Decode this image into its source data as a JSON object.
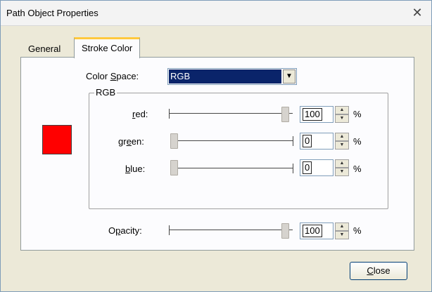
{
  "window": {
    "title": "Path Object Properties",
    "close_glyph": "✕"
  },
  "tabs": [
    {
      "label": "General",
      "active": false
    },
    {
      "label": "Stroke Color",
      "active": true
    }
  ],
  "color_space": {
    "label_pre": "Color ",
    "label_u": "S",
    "label_post": "pace:",
    "value": "RGB",
    "arrow": "▼"
  },
  "rgb_group": {
    "legend": "RGB"
  },
  "swatch": {
    "color": "#ff0000"
  },
  "channels": {
    "red": {
      "label_u": "r",
      "label_post": "ed:",
      "value": "100",
      "level": 1.0
    },
    "green": {
      "label_pre": "gr",
      "label_u": "e",
      "label_post": "en:",
      "value": "0",
      "level": 0.0
    },
    "blue": {
      "label_u": "b",
      "label_post": "lue:",
      "value": "0",
      "level": 0.0
    }
  },
  "opacity": {
    "label_pre": "O",
    "label_u": "p",
    "label_post": "acity:",
    "value": "100",
    "level": 1.0
  },
  "units": {
    "percent": "%"
  },
  "spin_glyphs": {
    "up": "▲",
    "down": "▼"
  },
  "buttons": {
    "close_u": "C",
    "close_post": "lose"
  }
}
